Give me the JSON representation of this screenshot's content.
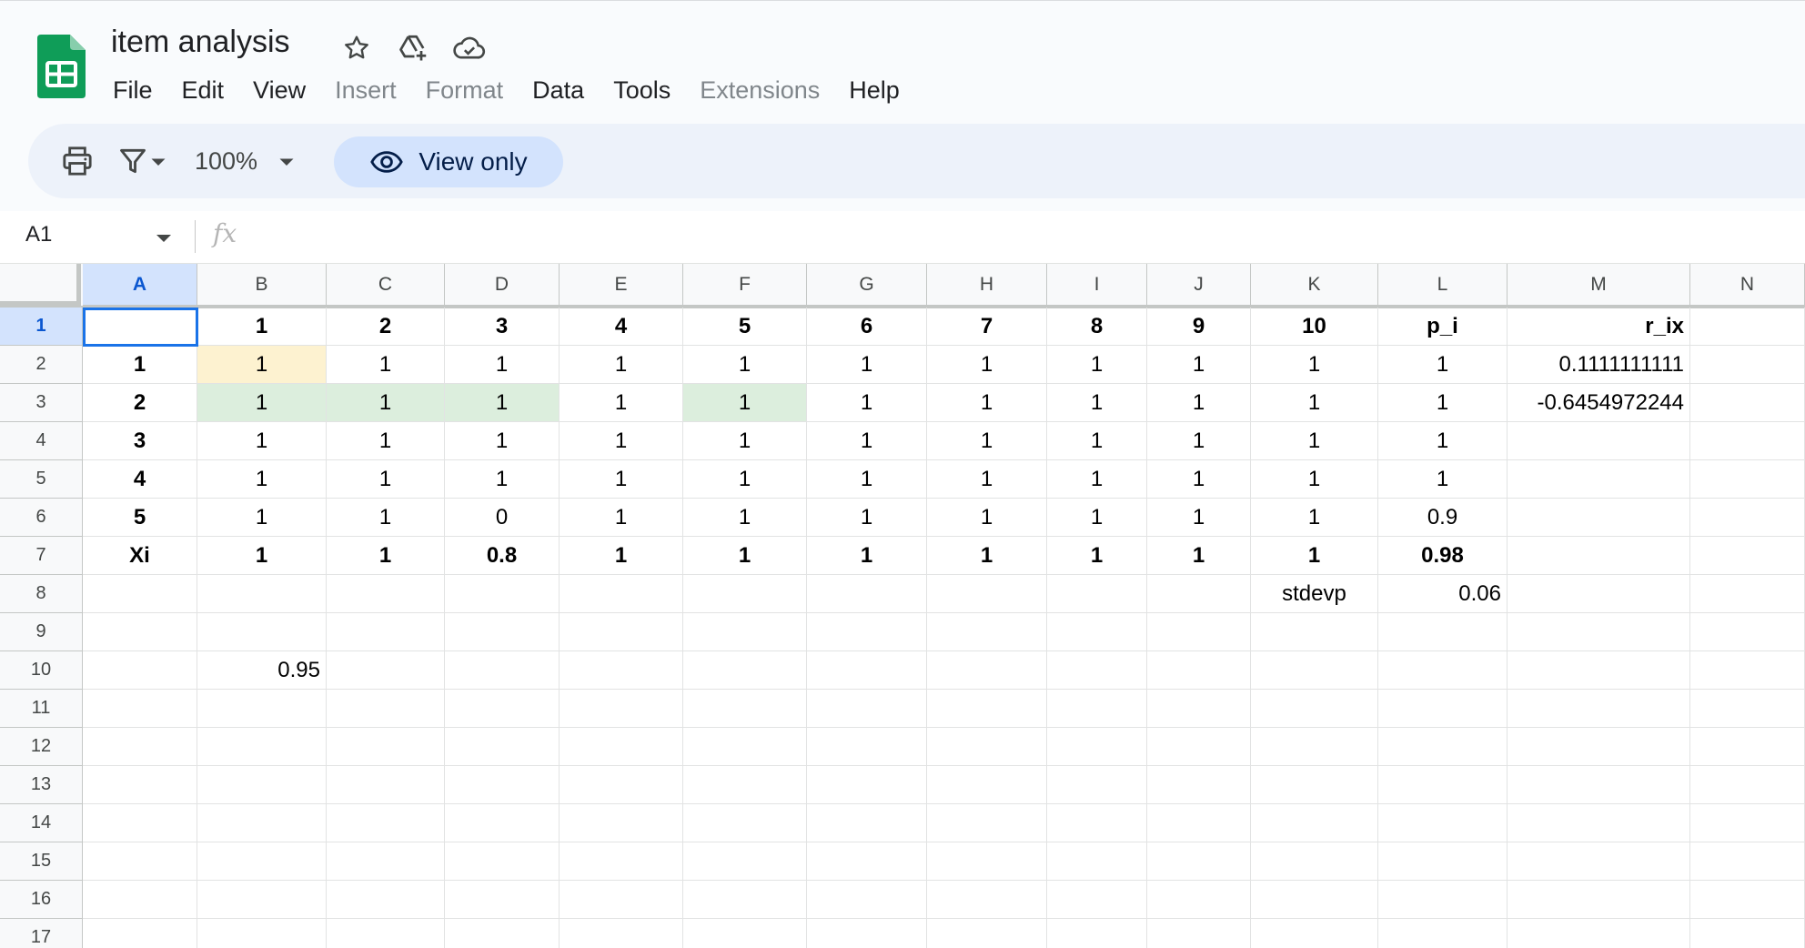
{
  "app": {
    "title": "item analysis",
    "brand_color": "#0f9d58"
  },
  "title_icons": [
    "star-icon",
    "move-to-drive-icon",
    "cloud-saved-icon"
  ],
  "menu": [
    {
      "label": "File",
      "disabled": false
    },
    {
      "label": "Edit",
      "disabled": false
    },
    {
      "label": "View",
      "disabled": false
    },
    {
      "label": "Insert",
      "disabled": true
    },
    {
      "label": "Format",
      "disabled": true
    },
    {
      "label": "Data",
      "disabled": false
    },
    {
      "label": "Tools",
      "disabled": false
    },
    {
      "label": "Extensions",
      "disabled": true
    },
    {
      "label": "Help",
      "disabled": false
    }
  ],
  "toolbar": {
    "zoom": "100%",
    "view_only_label": "View only"
  },
  "formula_bar": {
    "name_box": "A1",
    "fx_label": "fx",
    "formula": ""
  },
  "grid": {
    "selected_cell": "A1",
    "columns": [
      "A",
      "B",
      "C",
      "D",
      "E",
      "F",
      "G",
      "H",
      "I",
      "J",
      "K",
      "L",
      "M",
      "N"
    ],
    "rows": [
      {
        "n": "1",
        "cells": {
          "B": "1",
          "C": "2",
          "D": "3",
          "E": "4",
          "F": "5",
          "G": "6",
          "H": "7",
          "I": "8",
          "J": "9",
          "K": "10",
          "L": "p_i",
          "M": "r_ix"
        },
        "bold": true
      },
      {
        "n": "2",
        "cells": {
          "A": "1",
          "B": "1",
          "C": "1",
          "D": "1",
          "E": "1",
          "F": "1",
          "G": "1",
          "H": "1",
          "I": "1",
          "J": "1",
          "K": "1",
          "L": "1",
          "M": "0.1111111111"
        }
      },
      {
        "n": "3",
        "cells": {
          "A": "2",
          "B": "1",
          "C": "1",
          "D": "1",
          "E": "1",
          "F": "1",
          "G": "1",
          "H": "1",
          "I": "1",
          "J": "1",
          "K": "1",
          "L": "1",
          "M": "-0.6454972244"
        }
      },
      {
        "n": "4",
        "cells": {
          "A": "3",
          "B": "1",
          "C": "1",
          "D": "1",
          "E": "1",
          "F": "1",
          "G": "1",
          "H": "1",
          "I": "1",
          "J": "1",
          "K": "1",
          "L": "1"
        }
      },
      {
        "n": "5",
        "cells": {
          "A": "4",
          "B": "1",
          "C": "1",
          "D": "1",
          "E": "1",
          "F": "1",
          "G": "1",
          "H": "1",
          "I": "1",
          "J": "1",
          "K": "1",
          "L": "1"
        }
      },
      {
        "n": "6",
        "cells": {
          "A": "5",
          "B": "1",
          "C": "1",
          "D": "0",
          "E": "1",
          "F": "1",
          "G": "1",
          "H": "1",
          "I": "1",
          "J": "1",
          "K": "1",
          "L": "0.9"
        }
      },
      {
        "n": "7",
        "cells": {
          "A": "Xi",
          "B": "1",
          "C": "1",
          "D": "0.8",
          "E": "1",
          "F": "1",
          "G": "1",
          "H": "1",
          "I": "1",
          "J": "1",
          "K": "1",
          "L": "0.98"
        },
        "bold": true
      },
      {
        "n": "8",
        "cells": {
          "K": "stdevp",
          "L": "0.06"
        }
      },
      {
        "n": "9",
        "cells": {}
      },
      {
        "n": "10",
        "cells": {
          "B": "0.95"
        }
      },
      {
        "n": "11",
        "cells": {}
      },
      {
        "n": "12",
        "cells": {}
      },
      {
        "n": "13",
        "cells": {}
      },
      {
        "n": "14",
        "cells": {}
      },
      {
        "n": "15",
        "cells": {}
      },
      {
        "n": "16",
        "cells": {}
      },
      {
        "n": "17",
        "cells": {}
      }
    ],
    "highlights": {
      "B2": "#fdf2d0",
      "B3": "#dceedd",
      "C3": "#dceedd",
      "D3": "#dceedd",
      "F3": "#dceedd"
    }
  }
}
